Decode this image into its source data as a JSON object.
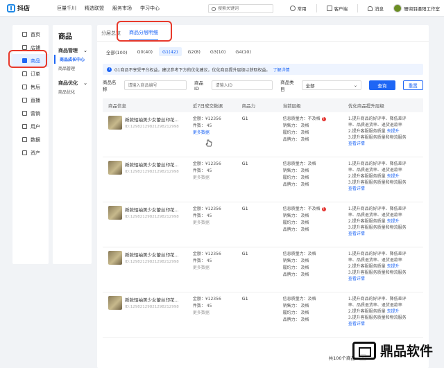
{
  "topbar": {
    "brand": "抖店",
    "nav": [
      "巨量千川",
      "精选联盟",
      "服务市场",
      "学习中心"
    ],
    "search_placeholder": "搜索关键词",
    "right": [
      "常用",
      "客户端",
      "消息"
    ],
    "shop_name": "珊瑚羽摄阳工作室"
  },
  "sidebar": {
    "items": [
      {
        "label": "首页",
        "icon": "home-icon"
      },
      {
        "label": "店铺",
        "icon": "store-icon"
      },
      {
        "label": "商品",
        "icon": "goods-icon",
        "active": true
      },
      {
        "label": "订单",
        "icon": "order-icon"
      },
      {
        "label": "售后",
        "icon": "aftersale-icon"
      },
      {
        "label": "直播",
        "icon": "live-icon"
      },
      {
        "label": "营销",
        "icon": "marketing-icon"
      },
      {
        "label": "用户",
        "icon": "user-icon"
      },
      {
        "label": "数据",
        "icon": "data-icon"
      },
      {
        "label": "资产",
        "icon": "asset-icon"
      }
    ]
  },
  "submenu": {
    "title": "商品",
    "groups": [
      {
        "label": "商品管理",
        "items": [
          "商品成长中心",
          "商品管理"
        ]
      },
      {
        "label": "商品优化",
        "items": [
          "商品优化"
        ]
      }
    ]
  },
  "tabs": [
    "分层总览",
    "商品分层明细"
  ],
  "chips": [
    "全部(100)",
    "G0(40)",
    "G1(42)",
    "G2(8)",
    "G3(10)",
    "G4(10)"
  ],
  "notice": {
    "text": "G1商品不享受平台权益，建议参考下方的优化建议，优化商品提升层级以获取权益。",
    "link": "了解详情"
  },
  "filters": {
    "name_label": "商品名称",
    "name_placeholder": "请输入商品编号",
    "id_label": "商品ID",
    "id_placeholder": "请输入ID",
    "cat_label": "商品类目",
    "cat_value": "全部",
    "search": "查询",
    "reset": "重置"
  },
  "table": {
    "headers": [
      "商品信息",
      "近7日成交数据",
      "商品力",
      "当前层级",
      "优化商品提升层级"
    ],
    "rows": [
      {
        "title": "新款短袖美少女蕾丝印花...",
        "id": "ID:12982129821298212998",
        "amount": "金额：¥12356",
        "count": "件数：  45",
        "more": "更多数据",
        "grade": "G1",
        "q": "信息质量力：不及格",
        "warn": true,
        "s": "销售力：  及格",
        "l": "履约力：  及格",
        "b": "品牌力：  及格",
        "a1": "1.提升商品的好评率、降低差评",
        "a2": "率、品质退货率、退货退款率",
        "a3": "2.提升客服服务质量",
        "a3link": "去提升",
        "a4": "3.提升客服服务质量和物流服务",
        "a5": "查看详情"
      },
      {
        "title": "新款短袖美少女蕾丝印花...",
        "id": "ID:12982129821298212998",
        "amount": "金额：¥12356",
        "count": "件数：  45",
        "more": "更多数据",
        "grade": "G1",
        "q": "信息质量力：及格",
        "warn": false,
        "s": "销售力：  及格",
        "l": "履约力：  及格",
        "b": "品牌力：  及格",
        "a1": "1.提升商品的好评率、降低差评",
        "a2": "率、品质退货率、退货退款率",
        "a3": "2.提升客服服务质量",
        "a3link": "去提升",
        "a4": "3.提升客服服务质量和物流服务",
        "a5": "查看详情"
      },
      {
        "title": "新款短袖美少女蕾丝印花...",
        "id": "ID:12982129821298212998",
        "amount": "金额：¥12356",
        "count": "件数：  45",
        "more": "更多数据",
        "grade": "G1",
        "q": "信息质量力：不及格",
        "warn": true,
        "s": "销售力：  及格",
        "l": "履约力：  及格",
        "b": "品牌力：  及格",
        "a1": "1.提升商品的好评率、降低差评",
        "a2": "率、品质退货率、退货退款率",
        "a3": "2.提升客服服务质量",
        "a3link": "去提升",
        "a4": "3.提升客服服务质量和物流服务",
        "a5": "查看详情"
      },
      {
        "title": "新款短袖美少女蕾丝印花...",
        "id": "ID:12982129821298212998",
        "amount": "金额：¥12356",
        "count": "件数：  45",
        "more": "更多数据",
        "grade": "G1",
        "q": "信息质量力：及格",
        "warn": false,
        "s": "销售力：  及格",
        "l": "履约力：  及格",
        "b": "品牌力：  及格",
        "a1": "1.提升商品的好评率、降低差评",
        "a2": "率、品质退货率、退货退款率",
        "a3": "2.提升客服服务质量",
        "a3link": "去提升",
        "a4": "3.提升客服服务质量和物流服务",
        "a5": "查看详情"
      },
      {
        "title": "新款短袖美少女蕾丝印花...",
        "id": "ID:12982129821298212998",
        "amount": "金额：¥12356",
        "count": "件数：  45",
        "more": "更多数据",
        "grade": "G1",
        "q": "信息质量力：及格",
        "warn": false,
        "s": "销售力：  及格",
        "l": "履约力：  及格",
        "b": "品牌力：  及格",
        "a1": "1.提升商品的好评率、降低差评",
        "a2": "率、品质退货率、退货退款率",
        "a3": "2.提升客服服务质量",
        "a3link": "去提升",
        "a4": "3.提升客服服务质量和物流服务",
        "a5": "查看详情"
      }
    ]
  },
  "pager": {
    "total": "共100个商品"
  },
  "watermark": "鼎品软件",
  "colors": {
    "accent": "#1e66f5",
    "highlight": "#e8392b",
    "warn": "#e53935"
  }
}
